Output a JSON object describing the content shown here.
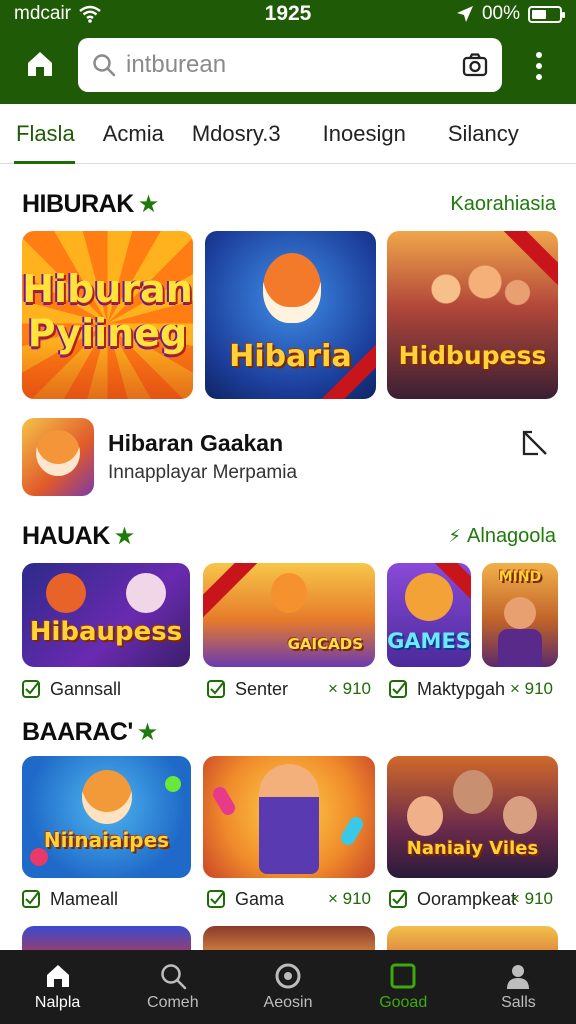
{
  "status": {
    "carrier": "mdcair",
    "time": "1925",
    "battery": "00%",
    "battery_level": 0.55
  },
  "search": {
    "placeholder": "intburean"
  },
  "tabs": [
    {
      "label": "Flasla"
    },
    {
      "label": "Acmia"
    },
    {
      "label": "Mdosry.3"
    },
    {
      "label": "Inoesign"
    },
    {
      "label": "Silancy"
    }
  ],
  "section1": {
    "title": "HIBURAK",
    "link": "Kaorahiasia",
    "tiles": [
      {
        "text": "Hiburan Pyiineg"
      },
      {
        "text": "Hibaria"
      },
      {
        "text": "Hidbupess"
      }
    ],
    "feature": {
      "title": "Hibaran Gaakan",
      "subtitle": "Innapplayar Merpamia"
    }
  },
  "section2": {
    "title": "HAUAK",
    "link": "Alnagoola",
    "tiles": [
      {
        "text": "Hibaupess"
      },
      {
        "text": "GAICADS"
      },
      {
        "text": "GAMES"
      },
      {
        "text": "MIND"
      }
    ],
    "captions": [
      {
        "label": "Gannsall"
      },
      {
        "label": "Senter",
        "count": "× 910"
      },
      {
        "label": "Maktypgah",
        "count": "× 910"
      }
    ]
  },
  "section3": {
    "title": "BAARAC'",
    "tiles": [
      {
        "text": "Niinaiaipes"
      },
      {
        "text": ""
      },
      {
        "text": "Naniaiy Viles"
      }
    ],
    "captions": [
      {
        "label": "Mameall"
      },
      {
        "label": "Gama",
        "count": "× 910"
      },
      {
        "label": "Oorampkeat",
        "count": "× 910"
      }
    ]
  },
  "bottom_nav": [
    {
      "label": "Nalpla",
      "icon": "home-icon"
    },
    {
      "label": "Comeh",
      "icon": "search-icon"
    },
    {
      "label": "Aeosin",
      "icon": "disc-icon"
    },
    {
      "label": "Gooad",
      "icon": "square-icon"
    },
    {
      "label": "Salls",
      "icon": "person-icon"
    }
  ],
  "colors": {
    "header": "#1f5a06",
    "accent": "#1f7a0c",
    "nav_bg": "#1b1b1b"
  }
}
